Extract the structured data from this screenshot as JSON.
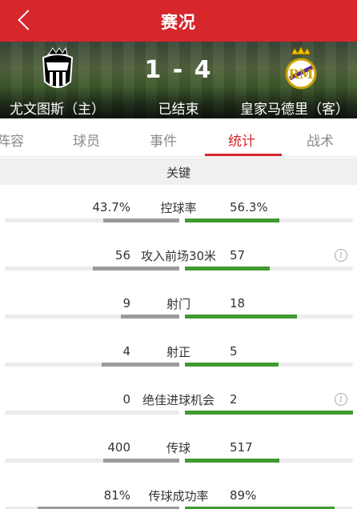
{
  "header": {
    "title": "赛况",
    "back_icon": "chevron-left-icon"
  },
  "match": {
    "home_team": "尤文图斯（主）",
    "away_team": "皇家马德里（客）",
    "score": "1 - 4",
    "status": "已结束",
    "home_crest_icon": "juventus-crest-icon",
    "away_crest_icon": "real-madrid-crest-icon"
  },
  "tabs": [
    {
      "label": "阵容",
      "active": false
    },
    {
      "label": "球员",
      "active": false
    },
    {
      "label": "事件",
      "active": false
    },
    {
      "label": "统计",
      "active": true
    },
    {
      "label": "战术",
      "active": false
    }
  ],
  "section": {
    "title": "关键"
  },
  "stats": [
    {
      "label": "控球率",
      "home": "43.7%",
      "away": "56.3%",
      "home_share": 0.437,
      "away_share": 0.563,
      "info": false
    },
    {
      "label": "攻入前场30米",
      "home": "56",
      "away": "57",
      "home_share": 0.496,
      "away_share": 0.504,
      "info": true
    },
    {
      "label": "射门",
      "home": "9",
      "away": "18",
      "home_share": 0.333,
      "away_share": 0.667,
      "info": false
    },
    {
      "label": "射正",
      "home": "4",
      "away": "5",
      "home_share": 0.444,
      "away_share": 0.556,
      "info": false
    },
    {
      "label": "绝佳进球机会",
      "home": "0",
      "away": "2",
      "home_share": 0.0,
      "away_share": 1.0,
      "info": true
    },
    {
      "label": "传球",
      "home": "400",
      "away": "517",
      "home_share": 0.436,
      "away_share": 0.564,
      "info": false
    },
    {
      "label": "传球成功率",
      "home": "81%",
      "away": "89%",
      "home_share": 0.81,
      "away_share": 0.89,
      "info": false
    }
  ],
  "colors": {
    "brand": "#d7262c",
    "home_bar": "#9b9b9b",
    "away_bar": "#3f9a2f"
  }
}
